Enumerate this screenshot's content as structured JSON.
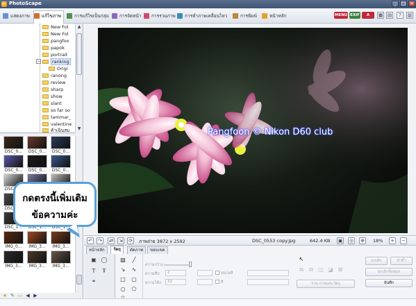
{
  "titlebar": {
    "title": "PhotoScape"
  },
  "tabs": [
    {
      "label": "แสดงภาพ"
    },
    {
      "label": "แก้ไขภาพ"
    },
    {
      "label": "การแก้ไขเป็นกลุ่ม"
    },
    {
      "label": "การจัดหน้า"
    },
    {
      "label": "การรวมภาพ"
    },
    {
      "label": "การทำภาพเคลื่อนไหว"
    },
    {
      "label": "การพิมพ์"
    },
    {
      "label": "หน้าหลัก"
    }
  ],
  "right_buttons": [
    {
      "label": "MENU",
      "color": "#c0283a"
    },
    {
      "label": "EXIF",
      "color": "#3f7f3f"
    },
    {
      "label": "A",
      "color": "#c0283a"
    }
  ],
  "folder_tree": [
    {
      "label": "New Fol"
    },
    {
      "label": "New Fol"
    },
    {
      "label": "pangfoo"
    },
    {
      "label": "papok"
    },
    {
      "label": "portrait"
    },
    {
      "label": "ranking",
      "selected": true
    },
    {
      "label": "Origi"
    },
    {
      "label": "ranong"
    },
    {
      "label": "review"
    },
    {
      "label": "sharp"
    },
    {
      "label": "show"
    },
    {
      "label": "slant"
    },
    {
      "label": "so far so"
    },
    {
      "label": "tammar_"
    },
    {
      "label": "valentine"
    },
    {
      "label": "ค้าเฉินสม"
    }
  ],
  "thumbnails": [
    {
      "caption": "DSC_0..."
    },
    {
      "caption": "DSC_0..."
    },
    {
      "caption": "DSC_0..."
    },
    {
      "caption": "DSC_0..."
    },
    {
      "caption": "DSC_0..."
    },
    {
      "caption": "DSC_0..."
    },
    {
      "caption": "DSC_0..."
    },
    {
      "caption": ""
    },
    {
      "caption": ""
    },
    {
      "caption": "DSC_0..."
    },
    {
      "caption": ""
    },
    {
      "caption": ""
    },
    {
      "caption": "DSC_1..."
    },
    {
      "caption": "DSC_1..."
    },
    {
      "caption": "DSC_1..."
    },
    {
      "caption": "IMG_0..."
    },
    {
      "caption": "IMG_3..."
    },
    {
      "caption": "IMG_3..."
    },
    {
      "caption": "IMG_3..."
    },
    {
      "caption": "IMG_3..."
    },
    {
      "caption": "IMG_3..."
    }
  ],
  "photo": {
    "watermark": "Pangfoon © Nikon D60 club"
  },
  "callout": {
    "line1": "กดตรงนี้เพิ่มเติม",
    "line2": "ข้อความค่ะ"
  },
  "statusbar": {
    "dimensions": "ภาพถ่าย 3872 x 2592",
    "filename": "DSC_0553 copy.jpg",
    "filesize": "642.4 KB",
    "zoom": "18%"
  },
  "edit_tabs": [
    {
      "label": "หน้าหลัก"
    },
    {
      "label": "วัตถุ",
      "active": true
    },
    {
      "label": "ตัดภาพ"
    },
    {
      "label": "ขอบเขต"
    }
  ],
  "props": {
    "label1": "ความกว้าง",
    "label2": "ความทึบ",
    "label3": "ความโค้ง",
    "value2": "2",
    "value3": "32",
    "check1": "ขนาดสี",
    "check2": "สี",
    "merge_button": "รวม ภาพและวัตถุ"
  },
  "action_buttons": {
    "cancel": "ยกเลิก",
    "redo": "ทำซ้ำ",
    "cancel_all": "ยกเลิกทั้งหมด",
    "save": "บันทึก"
  }
}
